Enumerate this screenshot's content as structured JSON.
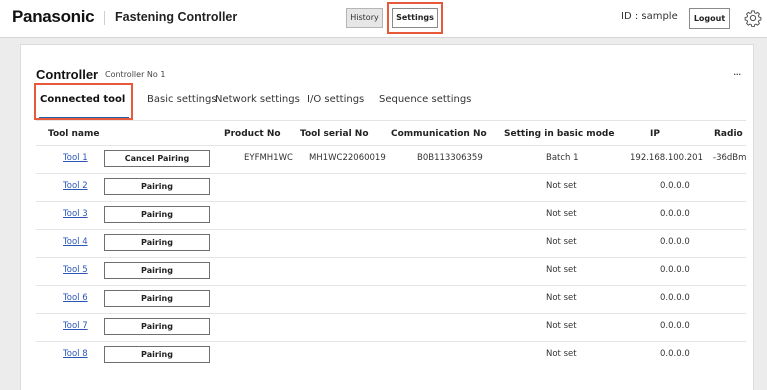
{
  "header": {
    "brand": "Panasonic",
    "app_title": "Fastening Controller",
    "history_label": "History",
    "settings_label": "Settings",
    "user_id": "ID : sample",
    "logout_label": "Logout",
    "settings_icon": "gear-icon",
    "highlight_color": "#e8583a"
  },
  "controller": {
    "title": "Controller",
    "subtitle": "Controller No 1",
    "more_label": "..."
  },
  "tabs": [
    {
      "label": "Connected tool",
      "active": true
    },
    {
      "label": "Basic settings",
      "active": false
    },
    {
      "label": "Network settings",
      "active": false
    },
    {
      "label": "I/O settings",
      "active": false
    },
    {
      "label": "Sequence settings",
      "active": false
    }
  ],
  "table": {
    "headers": [
      "Tool name",
      "Product No",
      "Tool serial No",
      "Communication No",
      "Setting in basic mode",
      "IP",
      "Radio"
    ],
    "rows": [
      {
        "tool": "Tool 1",
        "action": "Cancel Pairing",
        "product": "EYFMH1WC",
        "serial": "MH1WC22060019",
        "comm": "B0B113306359",
        "mode": "Batch 1",
        "ip": "192.168.100.201",
        "radio": "-36dBm"
      },
      {
        "tool": "Tool 2",
        "action": "Pairing",
        "product": "",
        "serial": "",
        "comm": "",
        "mode": "Not set",
        "ip": "0.0.0.0",
        "radio": ""
      },
      {
        "tool": "Tool 3",
        "action": "Pairing",
        "product": "",
        "serial": "",
        "comm": "",
        "mode": "Not set",
        "ip": "0.0.0.0",
        "radio": ""
      },
      {
        "tool": "Tool 4",
        "action": "Pairing",
        "product": "",
        "serial": "",
        "comm": "",
        "mode": "Not set",
        "ip": "0.0.0.0",
        "radio": ""
      },
      {
        "tool": "Tool 5",
        "action": "Pairing",
        "product": "",
        "serial": "",
        "comm": "",
        "mode": "Not set",
        "ip": "0.0.0.0",
        "radio": ""
      },
      {
        "tool": "Tool 6",
        "action": "Pairing",
        "product": "",
        "serial": "",
        "comm": "",
        "mode": "Not set",
        "ip": "0.0.0.0",
        "radio": ""
      },
      {
        "tool": "Tool 7",
        "action": "Pairing",
        "product": "",
        "serial": "",
        "comm": "",
        "mode": "Not set",
        "ip": "0.0.0.0",
        "radio": ""
      },
      {
        "tool": "Tool 8",
        "action": "Pairing",
        "product": "",
        "serial": "",
        "comm": "",
        "mode": "Not set",
        "ip": "0.0.0.0",
        "radio": ""
      }
    ]
  }
}
